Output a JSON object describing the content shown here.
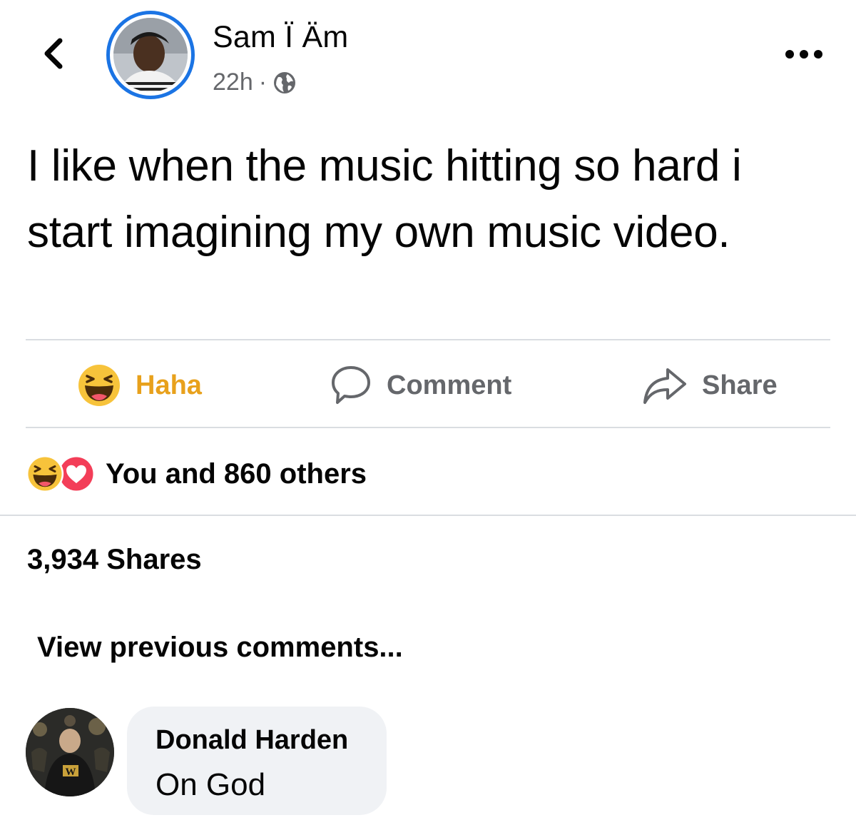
{
  "header": {
    "back_icon": "chevron-left-icon",
    "author_name": "Sam Ï Äm",
    "timestamp": "22h",
    "separator": "·",
    "privacy_icon": "globe-icon",
    "more_icon": "more-horizontal-icon"
  },
  "post": {
    "text": "I like when the music hitting so hard i start imagining my own music video."
  },
  "actions": {
    "haha_label": "Haha",
    "comment_label": "Comment",
    "share_label": "Share"
  },
  "reactions": {
    "icons": [
      "haha-icon",
      "love-icon"
    ],
    "summary": "You and 860 others"
  },
  "stats": {
    "shares": "3,934 Shares"
  },
  "comments": {
    "view_previous": "View previous comments...",
    "items": [
      {
        "author": "Donald Harden",
        "text": "On God"
      }
    ]
  },
  "colors": {
    "accent": "#1b74e4",
    "haha": "#e8a11c",
    "secondary_text": "#65676b",
    "bubble_bg": "#f0f2f5",
    "love": "#f33e58"
  }
}
